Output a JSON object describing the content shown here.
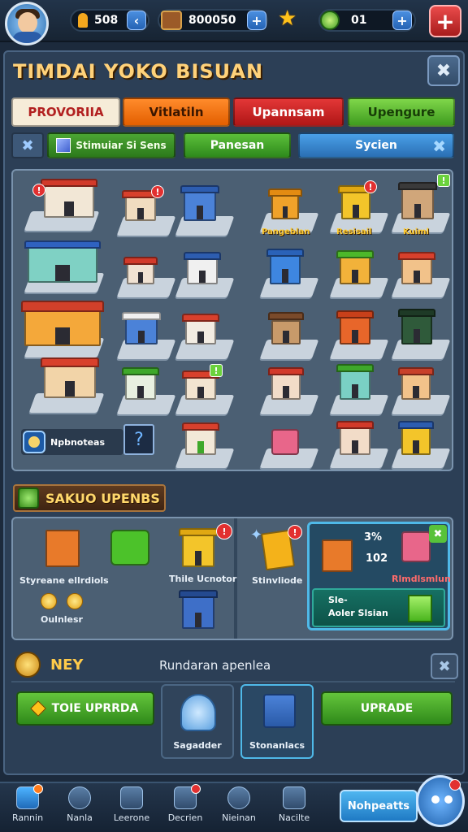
{
  "topbar": {
    "carrots": "508",
    "coins": "800050",
    "gems": "01"
  },
  "title": "TIMDAI YOKO BISUAN",
  "tabs": [
    "PROVORIIA",
    "Vitlatiln",
    "Upannsam",
    "Upengure"
  ],
  "subnav": {
    "simulator": "Stimuiar Si Sens",
    "panel": "Panesan",
    "search": "Sycien"
  },
  "grid": {
    "labels": [
      "Pangeblan",
      "Resisail",
      "Kuiml"
    ],
    "info_text": "Npbnoteas",
    "monitor_glyph": "?"
  },
  "section_title": "SAKUO UPENBS",
  "upgrades": {
    "items": [
      {
        "label": "Styreane ellrdiols"
      },
      {
        "label": "Thile Ucnotor"
      },
      {
        "label": "Stinvliode"
      }
    ],
    "coins_label": "Oulnlesr",
    "card": {
      "v1": "3%",
      "v2": "102",
      "red_label": "Rlmdlsmlun",
      "sub_line1": "Sle-",
      "sub_line2": "Aoler Slsian"
    }
  },
  "next": {
    "label": "NEY",
    "desc": "Rundaran apenlea"
  },
  "actions": {
    "left_button": "TOIE UPRRDA",
    "right_button": "UPRADE",
    "card1": "Sagadder",
    "card2": "Stonanlacs"
  },
  "bottom_nav": [
    "Rannin",
    "Nanla",
    "Leerone",
    "Decrien",
    "Nieinan",
    "Nacilte"
  ],
  "bottom_button": "Nohpeatts",
  "colors": {
    "accent_gold": "#ffd27a",
    "panel_bg": "#2c3f56",
    "highlight_blue": "#4fb9e8"
  }
}
